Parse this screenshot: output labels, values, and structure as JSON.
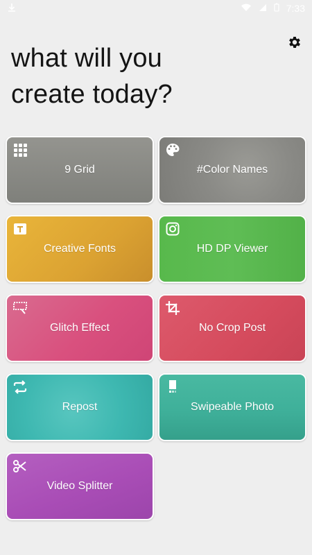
{
  "status_bar": {
    "time": "7:33"
  },
  "headline": {
    "line1": "what will you",
    "line2": "create today?"
  },
  "tools": [
    {
      "label": "9 Grid",
      "icon": "grid-icon",
      "color": "#8a8a85"
    },
    {
      "label": "#Color Names",
      "icon": "palette-icon",
      "color": "#8b8b87"
    },
    {
      "label": "Creative Fonts",
      "icon": "text-format-icon",
      "color": "#e0ad35"
    },
    {
      "label": "HD DP Viewer",
      "icon": "instagram-icon",
      "color": "#5bb94f"
    },
    {
      "label": "Glitch Effect",
      "icon": "glitch-icon",
      "color": "#d9567f"
    },
    {
      "label": "No Crop Post",
      "icon": "crop-icon",
      "color": "#d95364"
    },
    {
      "label": "Repost",
      "icon": "repost-icon",
      "color": "#3dbab3"
    },
    {
      "label": "Swipeable Photo",
      "icon": "swipe-photo-icon",
      "color": "#3fb29a"
    },
    {
      "label": "Video Splitter",
      "icon": "scissors-icon",
      "color": "#b257be"
    }
  ]
}
